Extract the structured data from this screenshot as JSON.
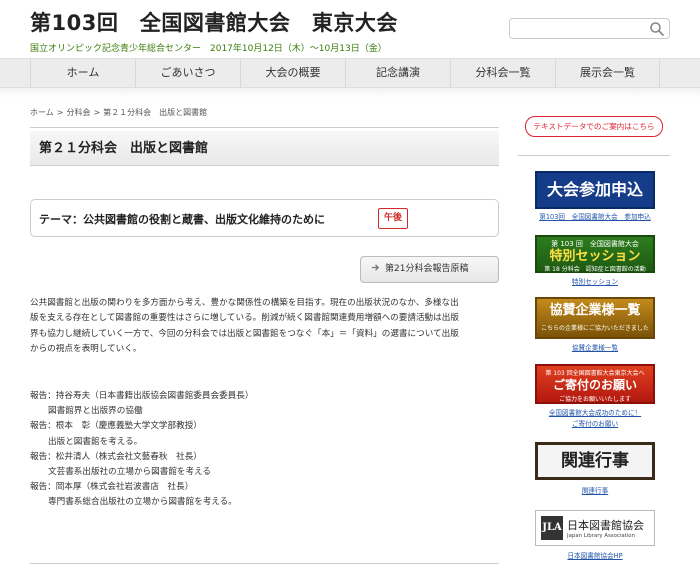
{
  "header": {
    "title": "第103回　全国図書館大会　東京大会",
    "subtitle": "国立オリンピック記念青少年総合センター　2017年10月12日（木）〜10月13日（金）"
  },
  "search": {
    "placeholder": "",
    "icon": "search-icon"
  },
  "nav": {
    "items": [
      "ホーム",
      "ごあいさつ",
      "大会の概要",
      "記念講演",
      "分科会一覧",
      "展示会一覧"
    ]
  },
  "breadcrumb": [
    "ホーム",
    "分科会",
    "第２１分科会　出版と図書館"
  ],
  "page": {
    "heading": "第２１分科会　出版と図書館",
    "theme": "テーマ：公共図書館の役割と蔵書、出版文化維持のために",
    "badge": "午後",
    "report_button": "第21分科会報告原稿",
    "description": [
      "公共図書館と出版の関わりを多方面から考え、豊かな関係性の構築を目指す。現在の出版状況のなか、多様な出",
      "版を支える存在として図書館の重要性はさらに増している。削減が続く図書館関連費用増額への要請活動は出版",
      "界も協力し継続していく一方で、今回の分科会では出版と図書館をつなぐ「本」＝「資料」の選書について出版",
      "からの視点を表明していく。"
    ],
    "reports": [
      {
        "speaker": "報告：持谷寿夫（日本書籍出版協会図書館委員会委員長）",
        "topic": "図書館界と出版界の協働"
      },
      {
        "speaker": "報告：根本　彰（慶應義塾大学文学部教授）",
        "topic": "出版と図書館を考える。"
      },
      {
        "speaker": "報告：松井清人（株式会社文藝春秋　社長）",
        "topic": "文芸書系出版社の立場から図書館を考える"
      },
      {
        "speaker": "報告：岡本厚（株式会社岩波書店　社長）",
        "topic": "専門書系総合出版社の立場から図書館を考える。"
      }
    ]
  },
  "sidebar": {
    "text_guide": "テキストデータでのご案内はこちら",
    "banners": [
      {
        "text": "大会参加申込",
        "caption": "第103回　全国図書館大会　参加申込"
      },
      {
        "line1": "第 103 回　全国図書館大会",
        "line2": "特別セッション",
        "line3": "第 18 分科会　認知症と図書館の活動",
        "caption": "特別セッション"
      },
      {
        "line1": "協賛企業様一覧",
        "line2": "こちらの企業様にご協力いただきました",
        "caption": "協賛企業様一覧"
      },
      {
        "line1": "第 103 回全国図書館大会東京大会へ",
        "line2": "ご寄付のお願い",
        "line3": "ご協力をお願いいたします",
        "caption1": "全国図書館大会成功のために！",
        "caption2": "ご寄付のお願い"
      },
      {
        "text": "関連行事",
        "caption": "関連行事"
      },
      {
        "logo": "JLA",
        "name": "日本図書館協会",
        "name_en": "Japan Library Association",
        "caption": "日本図書館協会HP"
      }
    ]
  },
  "colors": {
    "subtitle_green": "#3a7d0a",
    "badge_red": "#cf2a2a",
    "link_blue": "#2255aa",
    "nav_bg": "#ececec"
  }
}
